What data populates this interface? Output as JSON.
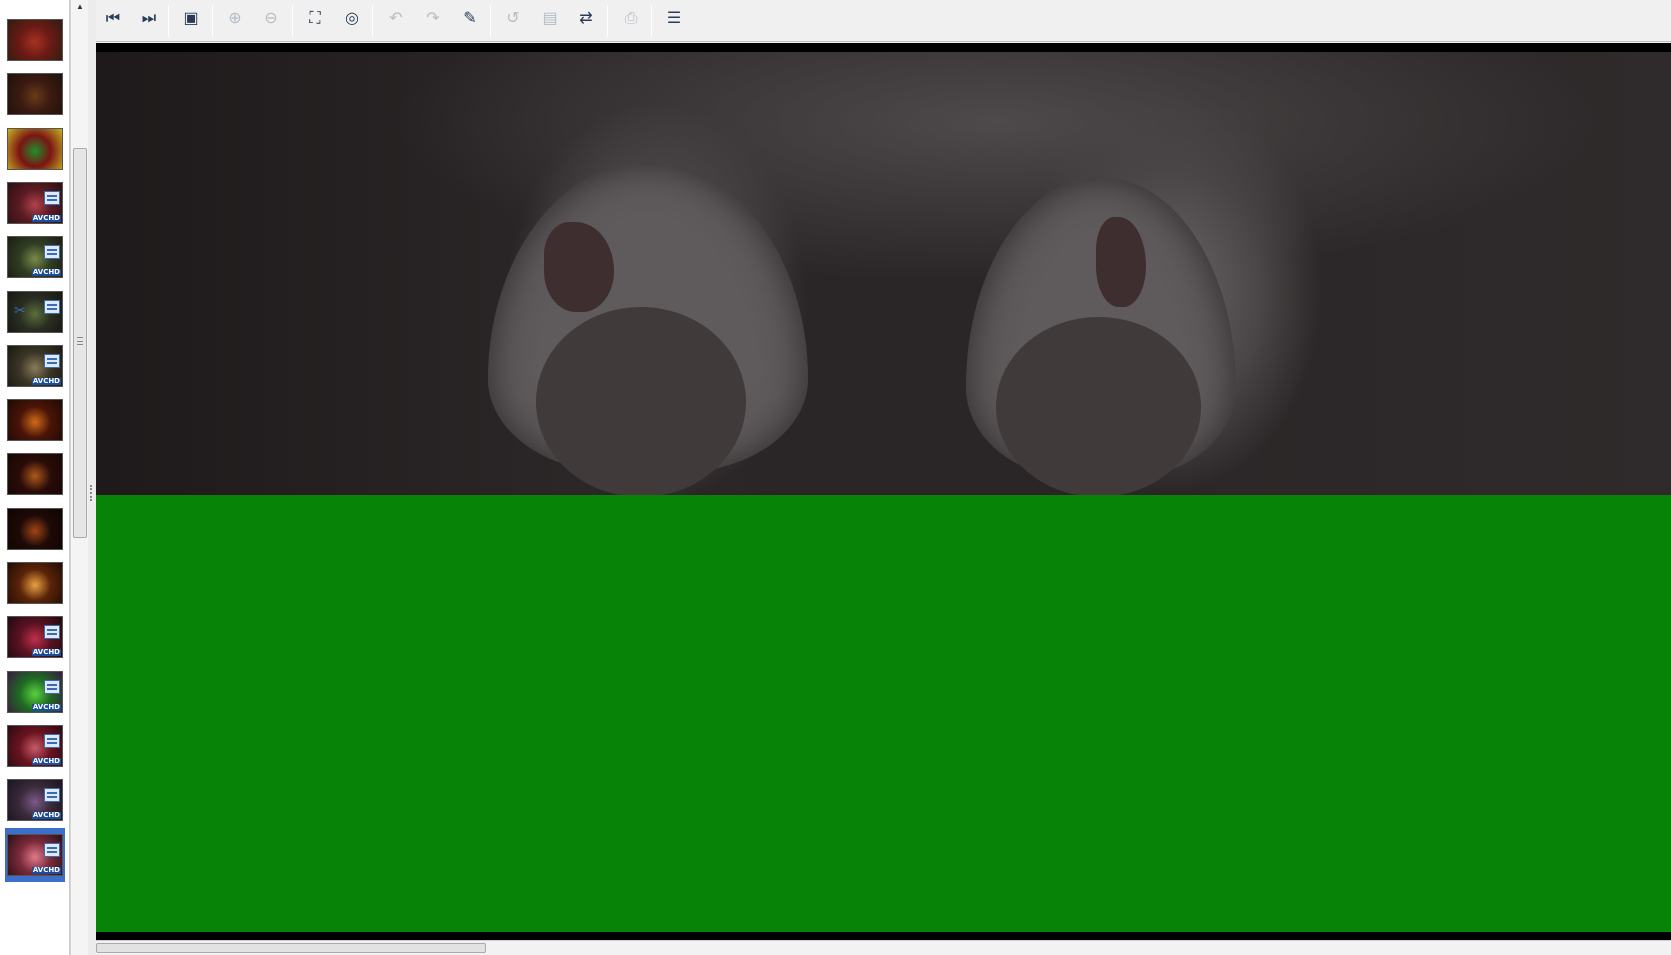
{
  "filmstrip": {
    "items": [
      {
        "kind": "photo",
        "colors": [
          "#6b1a14",
          "#a53322",
          "#2e1d12"
        ]
      },
      {
        "kind": "photo",
        "colors": [
          "#3b1a10",
          "#6a3a1a",
          "#1e120c"
        ]
      },
      {
        "kind": "photo",
        "colors": [
          "#7a1414",
          "#1f8f2a",
          "#c8b31f"
        ]
      },
      {
        "kind": "video",
        "badge": "AVCHD",
        "colors": [
          "#5a1b22",
          "#b2414e",
          "#2a1014"
        ]
      },
      {
        "kind": "video",
        "badge": "AVCHD",
        "colors": [
          "#2f3d22",
          "#7a8a4a",
          "#1c1c12"
        ]
      },
      {
        "kind": "video-cut",
        "colors": [
          "#2a2e22",
          "#5a6e3a",
          "#161612"
        ]
      },
      {
        "kind": "video",
        "badge": "AVCHD",
        "colors": [
          "#3a3526",
          "#8a7a5a",
          "#1a1812"
        ]
      },
      {
        "kind": "photo",
        "colors": [
          "#4a1408",
          "#d06a18",
          "#1e0a04"
        ]
      },
      {
        "kind": "photo",
        "colors": [
          "#2a0c08",
          "#b0581c",
          "#160604"
        ]
      },
      {
        "kind": "photo",
        "colors": [
          "#1e0a06",
          "#a04418",
          "#0e0402"
        ]
      },
      {
        "kind": "photo",
        "colors": [
          "#5a2408",
          "#e8a040",
          "#220c04"
        ]
      },
      {
        "kind": "video",
        "badge": "AVCHD",
        "colors": [
          "#5a1222",
          "#c0304a",
          "#22080e"
        ]
      },
      {
        "kind": "video",
        "badge": "AVCHD",
        "colors": [
          "#1e6a22",
          "#5ad040",
          "#3a1a40"
        ]
      },
      {
        "kind": "video",
        "badge": "AVCHD",
        "colors": [
          "#6a1420",
          "#c85a6a",
          "#2a0a12"
        ]
      },
      {
        "kind": "video",
        "badge": "AVCHD",
        "colors": [
          "#3a2a3a",
          "#7a5a8a",
          "#1a1420"
        ]
      },
      {
        "kind": "video",
        "badge": "AVCHD",
        "selected": true,
        "colors": [
          "#7a2a3a",
          "#e07a8a",
          "#2a1018"
        ]
      }
    ]
  },
  "toolbar": {
    "buttons": [
      {
        "name": "first-image-button",
        "icon": "skip-back-icon",
        "glyph": "⏮",
        "enabled": true
      },
      {
        "name": "last-image-button",
        "icon": "skip-forward-icon",
        "glyph": "⏭",
        "enabled": true
      },
      {
        "name": "slideshow-button",
        "icon": "slideshow-icon",
        "glyph": "▣",
        "enabled": true
      },
      {
        "name": "zoom-in-button",
        "icon": "zoom-in-icon",
        "glyph": "⊕",
        "enabled": false
      },
      {
        "name": "zoom-out-button",
        "icon": "zoom-out-icon",
        "glyph": "⊖",
        "enabled": false
      },
      {
        "name": "fit-to-window-button",
        "icon": "fit-window-icon",
        "glyph": "⛶",
        "enabled": true
      },
      {
        "name": "fullscreen-button",
        "icon": "fullscreen-icon",
        "glyph": "◎",
        "enabled": true
      },
      {
        "name": "rotate-left-button",
        "icon": "rotate-left-icon",
        "glyph": "↶",
        "enabled": false
      },
      {
        "name": "rotate-right-button",
        "icon": "rotate-right-icon",
        "glyph": "↷",
        "enabled": false
      },
      {
        "name": "edit-tools-button",
        "icon": "wand-icon",
        "glyph": "✎",
        "enabled": true
      },
      {
        "name": "undo-button",
        "icon": "undo-icon",
        "glyph": "↺",
        "enabled": false
      },
      {
        "name": "save-button",
        "icon": "save-icon",
        "glyph": "▤",
        "enabled": false
      },
      {
        "name": "export-button",
        "icon": "export-icon",
        "glyph": "⇄",
        "enabled": true
      },
      {
        "name": "print-button",
        "icon": "print-icon",
        "glyph": "⎙",
        "enabled": false
      },
      {
        "name": "properties-button",
        "icon": "properties-icon",
        "glyph": "☰",
        "enabled": true
      }
    ]
  },
  "viewer": {
    "background_color": "#000000",
    "overlay_color": "#078407"
  }
}
